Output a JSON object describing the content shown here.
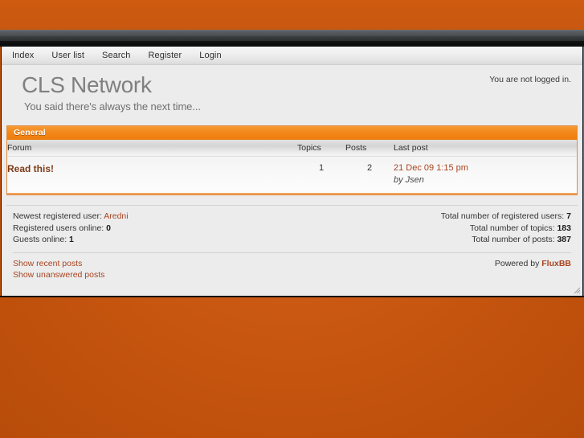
{
  "theme": {
    "desktop_orange": "#c85a10",
    "category_orange": "#f3881b",
    "link_brown": "#a94420",
    "forum_link_brown": "#7c3a17",
    "title_gray": "#808080",
    "page_bg": "#ececec"
  },
  "navbar": {
    "items": [
      {
        "label": "Index",
        "name": "nav-index"
      },
      {
        "label": "User list",
        "name": "nav-user-list"
      },
      {
        "label": "Search",
        "name": "nav-search"
      },
      {
        "label": "Register",
        "name": "nav-register"
      },
      {
        "label": "Login",
        "name": "nav-login"
      }
    ]
  },
  "header": {
    "board_title": "CLS Network",
    "board_description": "You said there's always the next time...",
    "login_status": "You are not logged in."
  },
  "category": {
    "name": "General"
  },
  "forum_table": {
    "columns": {
      "forum": "Forum",
      "topics": "Topics",
      "posts": "Posts",
      "last_post": "Last post"
    },
    "rows": [
      {
        "forum": "Read this!",
        "topics": "1",
        "posts": "2",
        "last_post_date": "21 Dec 09 1:15 pm",
        "last_post_author": "by Jsen"
      }
    ]
  },
  "stats": {
    "left": {
      "newest_user_label": "Newest registered user:",
      "newest_user_value": "Aredni",
      "users_online_label": "Registered users online:",
      "users_online_value": "0",
      "guests_online_label": "Guests online:",
      "guests_online_value": "1"
    },
    "right": {
      "total_users_label": "Total number of registered users:",
      "total_users_value": "7",
      "total_topics_label": "Total number of topics:",
      "total_topics_value": "183",
      "total_posts_label": "Total number of posts:",
      "total_posts_value": "387"
    }
  },
  "footer": {
    "show_recent_posts": "Show recent posts",
    "show_unanswered_posts": "Show unanswered posts",
    "powered_by_prefix": "Powered by",
    "powered_by_name": "FluxBB"
  }
}
